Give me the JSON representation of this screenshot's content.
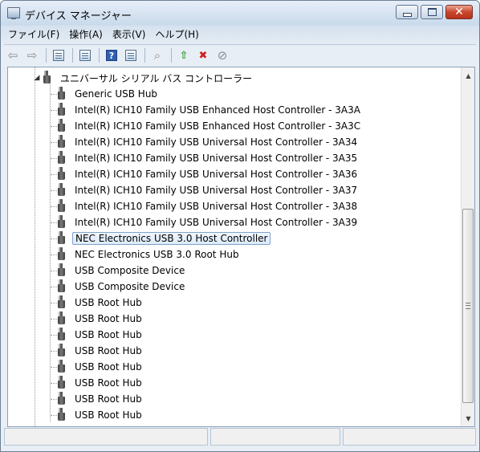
{
  "window": {
    "title": "デバイス マネージャー"
  },
  "menu": {
    "file": "ファイル(F)",
    "action": "操作(A)",
    "view": "表示(V)",
    "help": "ヘルプ(H)"
  },
  "toolbar": {
    "icons": [
      "back-arrow-icon",
      "forward-arrow-icon",
      "show-hide-console-tree-icon",
      "properties-icon",
      "help-icon",
      "action-pane-icon",
      "scan-hardware-icon",
      "update-driver-icon",
      "uninstall-icon",
      "disable-device-icon"
    ]
  },
  "tree": {
    "parent": "ユニバーサル シリアル バス コントローラー",
    "items": [
      "Generic USB Hub",
      "Intel(R) ICH10 Family USB Enhanced Host Controller - 3A3A",
      "Intel(R) ICH10 Family USB Enhanced Host Controller - 3A3C",
      "Intel(R) ICH10 Family USB Universal Host Controller - 3A34",
      "Intel(R) ICH10 Family USB Universal Host Controller - 3A35",
      "Intel(R) ICH10 Family USB Universal Host Controller - 3A36",
      "Intel(R) ICH10 Family USB Universal Host Controller - 3A37",
      "Intel(R) ICH10 Family USB Universal Host Controller - 3A38",
      "Intel(R) ICH10 Family USB Universal Host Controller - 3A39",
      "NEC Electronics USB 3.0 Host Controller",
      "NEC Electronics USB 3.0 Root Hub",
      "USB Composite Device",
      "USB Composite Device",
      "USB Root Hub",
      "USB Root Hub",
      "USB Root Hub",
      "USB Root Hub",
      "USB Root Hub",
      "USB Root Hub",
      "USB Root Hub",
      "USB Root Hub"
    ],
    "selected_item": "NEC Electronics USB 3.0 Host Controller"
  },
  "colors": {
    "selection_border": "#7da2ce",
    "selection_fill": "#dcebfc",
    "close_button": "#c9462c"
  }
}
